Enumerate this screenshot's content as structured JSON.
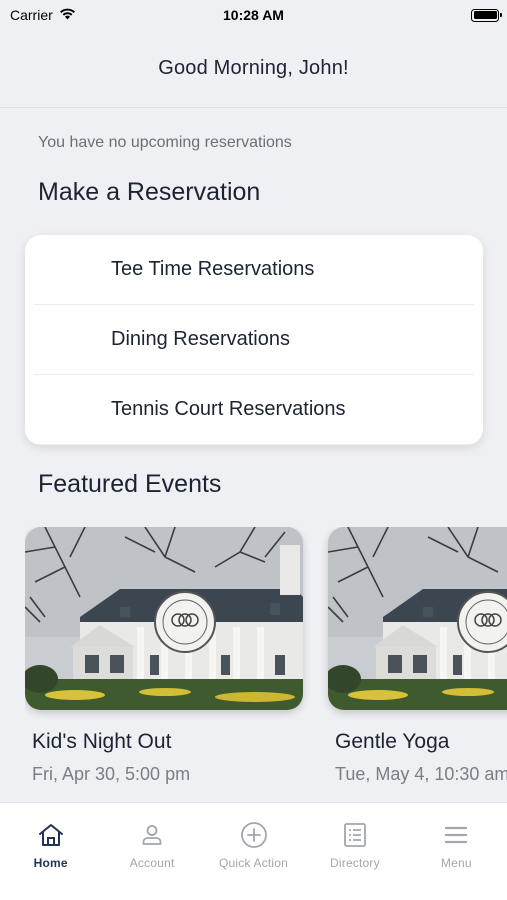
{
  "status_bar": {
    "carrier": "Carrier",
    "time": "10:28 AM"
  },
  "header": {
    "title": "Good Morning, John!"
  },
  "reservations": {
    "empty_text": "You have no upcoming reservations",
    "section_title": "Make a Reservation",
    "items": [
      {
        "label": "Tee Time Reservations"
      },
      {
        "label": "Dining Reservations"
      },
      {
        "label": "Tennis Court Reservations"
      }
    ]
  },
  "events": {
    "section_title": "Featured Events",
    "items": [
      {
        "title": "Kid's Night Out",
        "date": "Fri, Apr 30, 5:00 pm",
        "image": "clubhouse-photo"
      },
      {
        "title": "Gentle Yoga",
        "date": "Tue, May 4, 10:30 am",
        "image": "clubhouse-photo"
      }
    ]
  },
  "tab_bar": {
    "active_color": "#1f3456",
    "inactive_color": "#a3a6ad",
    "tabs": [
      {
        "label": "Home",
        "icon": "home-icon",
        "active": true
      },
      {
        "label": "Account",
        "icon": "person-icon",
        "active": false
      },
      {
        "label": "Quick Action",
        "icon": "plus-circle-icon",
        "active": false
      },
      {
        "label": "Directory",
        "icon": "list-icon",
        "active": false
      },
      {
        "label": "Menu",
        "icon": "hamburger-icon",
        "active": false
      }
    ]
  }
}
